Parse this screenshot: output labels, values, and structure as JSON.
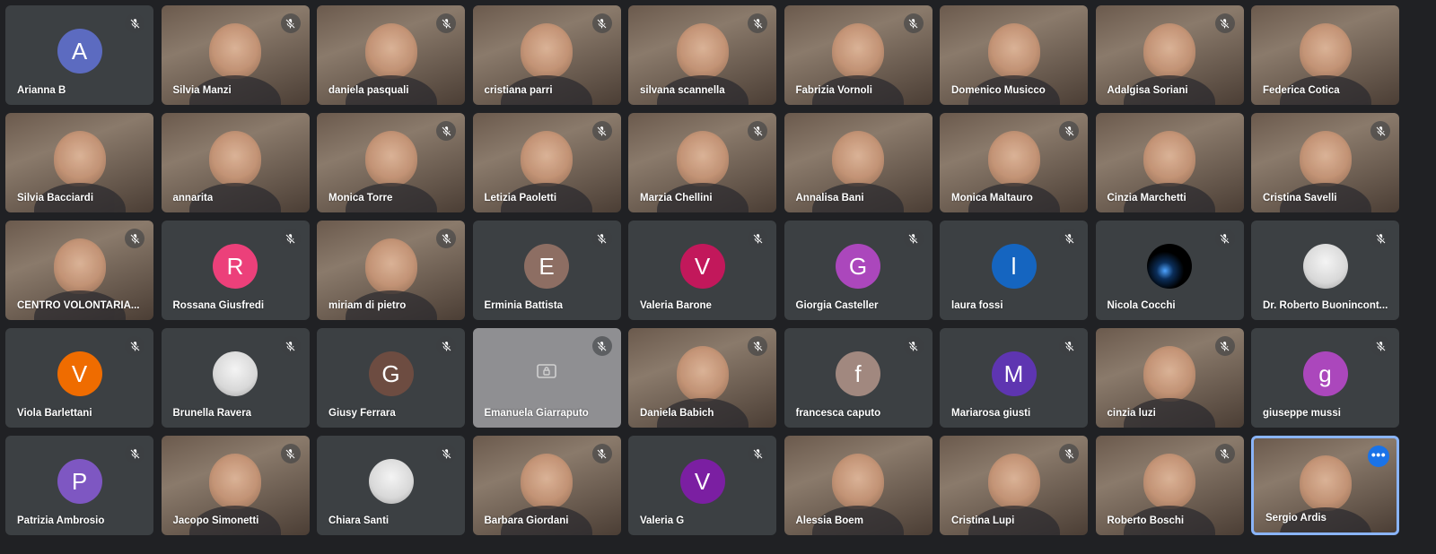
{
  "participants": [
    {
      "name": "Arianna B",
      "initial": "A",
      "color": "#5c6bc0",
      "type": "avatar",
      "muted": true
    },
    {
      "name": "Silvia Manzi",
      "type": "video",
      "muted": true
    },
    {
      "name": "daniela pasquali",
      "type": "video",
      "muted": true
    },
    {
      "name": "cristiana parri",
      "type": "video",
      "muted": true
    },
    {
      "name": "silvana scannella",
      "type": "video",
      "muted": true
    },
    {
      "name": "Fabrizia Vornoli",
      "type": "video",
      "muted": true
    },
    {
      "name": "Domenico Musicco",
      "type": "video",
      "muted": false
    },
    {
      "name": "Adalgisa Soriani",
      "type": "video",
      "muted": true
    },
    {
      "name": "Federica Cotica",
      "type": "video",
      "muted": false
    },
    {
      "name": "Silvia Bacciardi",
      "type": "video",
      "muted": false
    },
    {
      "name": "annarita",
      "type": "video",
      "muted": false
    },
    {
      "name": "Monica Torre",
      "type": "video",
      "muted": true
    },
    {
      "name": "Letizia Paoletti",
      "type": "video",
      "muted": true
    },
    {
      "name": "Marzia Chellini",
      "type": "video",
      "muted": true
    },
    {
      "name": "Annalisa Bani",
      "type": "video",
      "muted": false
    },
    {
      "name": "Monica Maltauro",
      "type": "video",
      "muted": true
    },
    {
      "name": "Cinzia Marchetti",
      "type": "video",
      "muted": false
    },
    {
      "name": "Cristina Savelli",
      "type": "video",
      "muted": true
    },
    {
      "name": "CENTRO VOLONTARIA...",
      "type": "video",
      "muted": true
    },
    {
      "name": "Rossana Giusfredi",
      "initial": "R",
      "color": "#ec407a",
      "type": "avatar",
      "muted": true
    },
    {
      "name": "miriam di pietro",
      "type": "video",
      "muted": true
    },
    {
      "name": "Erminia Battista",
      "initial": "E",
      "color": "#8d6e63",
      "type": "avatar",
      "muted": true
    },
    {
      "name": "Valeria Barone",
      "initial": "V",
      "color": "#c2185b",
      "type": "avatar",
      "muted": true
    },
    {
      "name": "Giorgia Casteller",
      "initial": "G",
      "color": "#ab47bc",
      "type": "avatar",
      "muted": true
    },
    {
      "name": "laura fossi",
      "initial": "l",
      "color": "#1565c0",
      "type": "avatar",
      "muted": true
    },
    {
      "name": "Nicola Cocchi",
      "type": "image-dark",
      "muted": true
    },
    {
      "name": "Dr. Roberto Buonincont...",
      "type": "image",
      "muted": true
    },
    {
      "name": "Viola Barlettani",
      "initial": "V",
      "color": "#ef6c00",
      "type": "avatar",
      "muted": true
    },
    {
      "name": "Brunella Ravera",
      "type": "image",
      "muted": true
    },
    {
      "name": "Giusy Ferrara",
      "initial": "G",
      "color": "#6d4c41",
      "type": "avatar",
      "muted": true
    },
    {
      "name": "Emanuela Giarraputo",
      "type": "presenting",
      "muted": true
    },
    {
      "name": "Daniela Babich",
      "type": "video",
      "muted": true
    },
    {
      "name": "francesca caputo",
      "initial": "f",
      "color": "#a1887f",
      "type": "avatar",
      "muted": true
    },
    {
      "name": "Mariarosa giusti",
      "initial": "M",
      "color": "#5e35b1",
      "type": "avatar",
      "muted": true
    },
    {
      "name": "cinzia luzi",
      "type": "video",
      "muted": true
    },
    {
      "name": "giuseppe mussi",
      "initial": "g",
      "color": "#ab47bc",
      "type": "avatar",
      "muted": true
    },
    {
      "name": "Patrizia Ambrosio",
      "initial": "P",
      "color": "#7e57c2",
      "type": "avatar",
      "muted": true
    },
    {
      "name": "Jacopo Simonetti",
      "type": "video",
      "muted": true
    },
    {
      "name": "Chiara Santi",
      "type": "image",
      "muted": true
    },
    {
      "name": "Barbara Giordani",
      "type": "video",
      "muted": true
    },
    {
      "name": "Valeria G",
      "initial": "V",
      "color": "#7b1fa2",
      "type": "avatar",
      "muted": true
    },
    {
      "name": "Alessia Boem",
      "type": "video",
      "muted": false
    },
    {
      "name": "Cristina Lupi",
      "type": "video",
      "muted": true
    },
    {
      "name": "Roberto Boschi",
      "type": "video",
      "muted": true
    },
    {
      "name": "Sergio Ardis",
      "type": "video",
      "muted": false,
      "speaking": true
    }
  ],
  "options_icon": "more-options-icon",
  "mute_icon": "mic-off-icon",
  "present_icon": "presentation-icon"
}
